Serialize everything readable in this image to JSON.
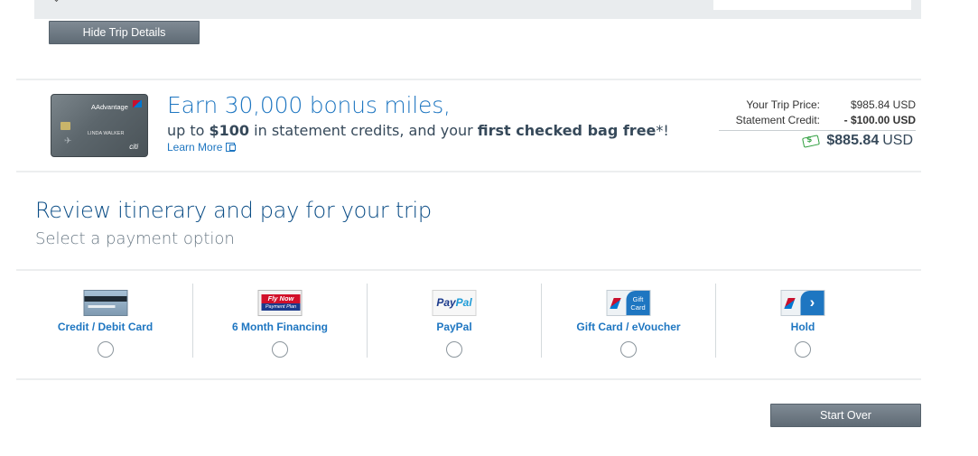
{
  "trip": {
    "hide_details_label": "Hide Trip Details"
  },
  "promo": {
    "card": {
      "brand": "AAdvantage",
      "cardholder": "LINDA WALKER",
      "issuer": "citi"
    },
    "headline": "Earn 30,000 bonus miles,",
    "sub_prefix": "up to ",
    "sub_amount": "$100",
    "sub_middle": " in statement credits, and your ",
    "sub_bold": "first checked bag free",
    "sub_suffix": "*!",
    "learn_more": "Learn More"
  },
  "pricing": {
    "trip_price_label": "Your Trip Price:",
    "trip_price_value": "$985.84 USD",
    "credit_label": "Statement Credit:",
    "credit_value": "- $100.00 USD",
    "total_amount": "$885.84",
    "total_currency": "USD",
    "accent_color": "#2e9e3e"
  },
  "review": {
    "title": "Review itinerary and pay for your trip",
    "subtitle": "Select a payment option"
  },
  "payment_options": [
    {
      "label": "Credit / Debit Card",
      "icon": "credit-card-icon"
    },
    {
      "label": "6 Month Financing",
      "icon": "fly-now-payment-plan-icon",
      "icon_text_1": "Fly Now",
      "icon_text_2": "Payment Plan"
    },
    {
      "label": "PayPal",
      "icon": "paypal-icon",
      "icon_text_1": "Pay",
      "icon_text_2": "Pal"
    },
    {
      "label": "Gift Card / eVoucher",
      "icon": "gift-card-icon",
      "icon_text_1": "Gift",
      "icon_text_2": "Card"
    },
    {
      "label": "Hold",
      "icon": "hold-arrow-icon"
    }
  ],
  "footer": {
    "start_over_label": "Start Over"
  },
  "colors": {
    "link_blue": "#1e76c1",
    "heading_blue": "#0b4d86",
    "button_gray": "#6f7a84"
  }
}
